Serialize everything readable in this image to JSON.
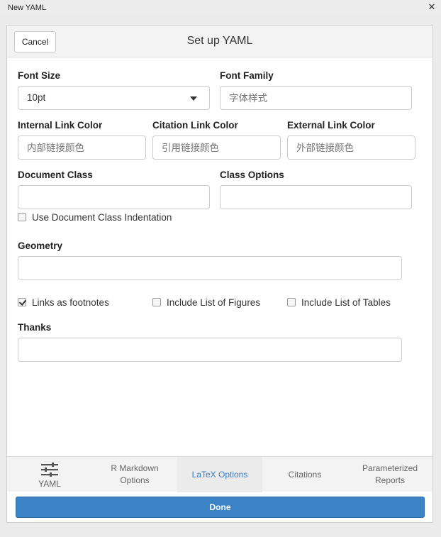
{
  "window": {
    "title": "New YAML",
    "close_glyph": "✕"
  },
  "header": {
    "cancel_label": "Cancel",
    "title": "Set up YAML"
  },
  "form": {
    "font_size": {
      "label": "Font Size",
      "value": "10pt"
    },
    "font_family": {
      "label": "Font Family",
      "placeholder": "字体样式"
    },
    "internal_link_color": {
      "label": "Internal Link Color",
      "placeholder": "内部链接颜色"
    },
    "citation_link_color": {
      "label": "Citation Link Color",
      "placeholder": "引用链接颜色"
    },
    "external_link_color": {
      "label": "External Link Color",
      "placeholder": "外部链接颜色"
    },
    "document_class": {
      "label": "Document Class",
      "value": ""
    },
    "class_options": {
      "label": "Class Options",
      "value": ""
    },
    "use_doc_class_indent": {
      "label": "Use Document Class Indentation",
      "checked": false
    },
    "geometry": {
      "label": "Geometry",
      "value": ""
    },
    "links_as_footnotes": {
      "label": "Links as footnotes",
      "checked": true
    },
    "include_list_figures": {
      "label": "Include List of Figures",
      "checked": false
    },
    "include_list_tables": {
      "label": "Include List of Tables",
      "checked": false
    },
    "thanks": {
      "label": "Thanks",
      "value": ""
    }
  },
  "tabs": [
    {
      "label": "YAML",
      "icon": "sliders-icon",
      "active": false
    },
    {
      "label": "R Markdown\nOptions",
      "line1": "R Markdown",
      "line2": "Options",
      "active": false
    },
    {
      "label": "LaTeX Options",
      "active": true
    },
    {
      "label": "Citations",
      "active": false
    },
    {
      "label": "Parameterized\nReports",
      "line1": "Parameterized",
      "line2": "Reports",
      "active": false
    }
  ],
  "footer": {
    "done_label": "Done"
  },
  "colors": {
    "accent": "#3c83c6",
    "active_tab_text": "#3a7ec3"
  }
}
